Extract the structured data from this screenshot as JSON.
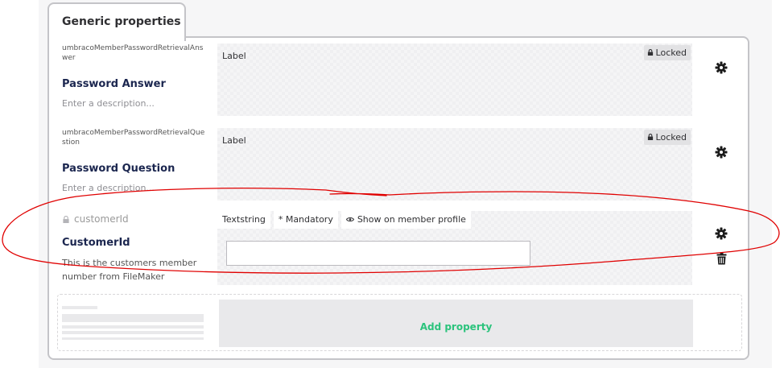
{
  "group": {
    "tab_label": "Generic properties"
  },
  "properties": [
    {
      "alias": "umbracoMemberPasswordRetrievalAnswer",
      "name": "Password Answer",
      "description_placeholder": "Enter a description...",
      "editor_label": "Label",
      "locked_label": "Locked"
    },
    {
      "alias": "umbracoMemberPasswordRetrievalQuestion",
      "name": "Password Question",
      "description_placeholder": "Enter a description...",
      "editor_label": "Label",
      "locked_label": "Locked"
    },
    {
      "alias": "customerId",
      "name": "CustomerId",
      "description": "This is the customers member number from FileMaker",
      "tags": [
        "Textstring",
        "* Mandatory",
        "Show on member profile"
      ],
      "input_value": ""
    }
  ],
  "icons": {
    "settings": "gear-icon",
    "delete": "trash-icon",
    "lock": "lock-icon",
    "eye": "eye-icon"
  },
  "add_property_label": "Add property",
  "colors": {
    "accent_green": "#2bc37c",
    "annotation_red": "#e00000",
    "locked_badge_bg": "#e2e2e4"
  }
}
